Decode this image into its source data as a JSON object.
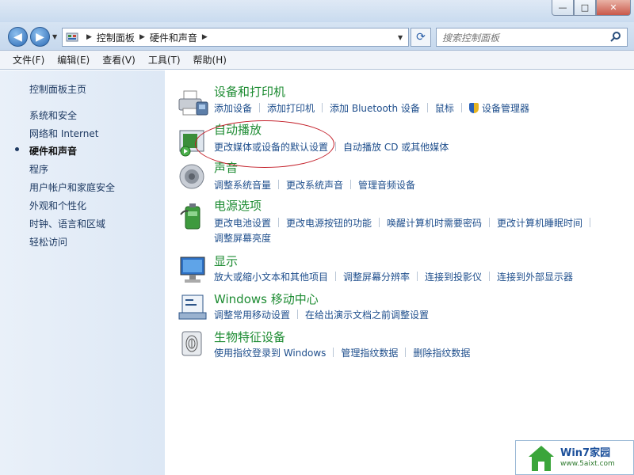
{
  "window": {
    "buttons": [
      "—",
      "□",
      "✕"
    ]
  },
  "nav": {
    "back": "◀",
    "forward": "▶",
    "recent": "▼",
    "breadcrumbs": [
      "控制面板",
      "硬件和声音"
    ],
    "refresh": "⟳",
    "search_placeholder": "搜索控制面板"
  },
  "menu": [
    "文件(F)",
    "编辑(E)",
    "查看(V)",
    "工具(T)",
    "帮助(H)"
  ],
  "sidebar": {
    "items": [
      {
        "label": "控制面板主页",
        "active": false
      },
      {
        "label": "系统和安全",
        "active": false
      },
      {
        "label": "网络和 Internet",
        "active": false
      },
      {
        "label": "硬件和声音",
        "active": true
      },
      {
        "label": "程序",
        "active": false
      },
      {
        "label": "用户帐户和家庭安全",
        "active": false
      },
      {
        "label": "外观和个性化",
        "active": false
      },
      {
        "label": "时钟、语言和区域",
        "active": false
      },
      {
        "label": "轻松访问",
        "active": false
      }
    ]
  },
  "categories": [
    {
      "title": "设备和打印机",
      "icon": "printer-icon",
      "links": [
        [
          "添加设备",
          "添加打印机",
          "添加 Bluetooth 设备",
          "鼠标",
          "设备管理器"
        ]
      ]
    },
    {
      "title": "自动播放",
      "icon": "autoplay-icon",
      "links": [
        [
          "更改媒体或设备的默认设置",
          "自动播放 CD 或其他媒体"
        ]
      ]
    },
    {
      "title": "声音",
      "icon": "speaker-icon",
      "links": [
        [
          "调整系统音量",
          "更改系统声音",
          "管理音频设备"
        ]
      ]
    },
    {
      "title": "电源选项",
      "icon": "battery-icon",
      "links": [
        [
          "更改电池设置",
          "更改电源按钮的功能",
          "唤醒计算机时需要密码",
          "更改计算机睡眠时间"
        ],
        [
          "调整屏幕亮度"
        ]
      ]
    },
    {
      "title": "显示",
      "icon": "monitor-icon",
      "links": [
        [
          "放大或缩小文本和其他项目",
          "调整屏幕分辨率",
          "连接到投影仪",
          "连接到外部显示器"
        ]
      ]
    },
    {
      "title": "Windows 移动中心",
      "icon": "mobility-center-icon",
      "links": [
        [
          "调整常用移动设置",
          "在给出演示文档之前调整设置"
        ]
      ]
    },
    {
      "title": "生物特征设备",
      "icon": "fingerprint-icon",
      "links": [
        [
          "使用指纹登录到 Windows",
          "管理指纹数据",
          "删除指纹数据"
        ]
      ]
    }
  ],
  "watermark": {
    "title": "Win7家园",
    "url": "www.5aixt.com"
  },
  "colors": {
    "category_title": "#1e8c33",
    "link": "#1e4e8c",
    "annotation": "#c31e28"
  }
}
